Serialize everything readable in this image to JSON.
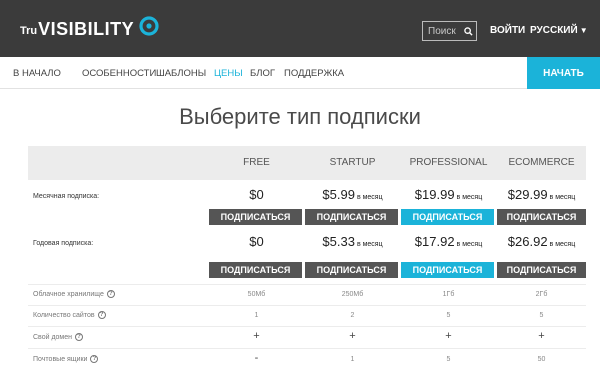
{
  "header": {
    "logo_prefix": "Tru",
    "logo_main": "VISIBILITY",
    "search_placeholder": "Поиск",
    "login": "ВОЙТИ",
    "language": "РУССКИЙ",
    "colors": {
      "bar": "#3b3b3b",
      "accent": "#1bb3d9"
    }
  },
  "nav": {
    "items": [
      "В НАЧАЛО",
      "ОСОБЕННОСТИ",
      "ШАБЛОНЫ",
      "ЦЕНЫ",
      "БЛОГ",
      "ПОДДЕРЖКА"
    ],
    "active": "ЦЕНЫ",
    "start_button": "НАЧАТЬ"
  },
  "page": {
    "title": "Выберите тип подписки"
  },
  "plans": [
    "FREE",
    "STARTUP",
    "PROFESSIONAL",
    "ECOMMERCE"
  ],
  "highlighted_plan": "PROFESSIONAL",
  "monthly": {
    "label": "Месячная подписка:",
    "prices": [
      "$0",
      "$5.99",
      "$19.99",
      "$29.99"
    ],
    "per": [
      "",
      "в месяц",
      "в месяц",
      "в месяц"
    ],
    "button": "ПОДПИСАТЬСЯ"
  },
  "yearly": {
    "label": "Годовая подписка:",
    "prices": [
      "$0",
      "$5.33",
      "$17.92",
      "$26.92"
    ],
    "per": [
      "",
      "в месяц",
      "в месяц",
      "в месяц"
    ],
    "button": "ПОДПИСАТЬСЯ"
  },
  "features": [
    {
      "label": "Облачное хранилище",
      "values": [
        "50Мб",
        "250Мб",
        "1Гб",
        "2Гб"
      ]
    },
    {
      "label": "Количество сайтов",
      "values": [
        "1",
        "2",
        "5",
        "5"
      ]
    },
    {
      "label": "Свой домен",
      "values": [
        "+",
        "+",
        "+",
        "+"
      ]
    },
    {
      "label": "Почтовые ящики",
      "values": [
        "-",
        "1",
        "5",
        "50"
      ]
    }
  ]
}
